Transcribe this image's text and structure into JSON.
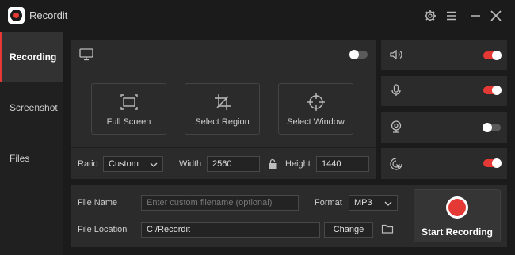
{
  "app": {
    "title": "Recordit"
  },
  "titlebar": {
    "icons": [
      "gear-icon",
      "menu-icon",
      "minimize-icon",
      "close-icon"
    ]
  },
  "sidebar": {
    "items": [
      {
        "label": "Recording",
        "active": true
      },
      {
        "label": "Screenshot",
        "active": false
      },
      {
        "label": "Files",
        "active": false
      }
    ]
  },
  "screen": {
    "toggle_on": false
  },
  "modes": [
    {
      "label": "Full Screen"
    },
    {
      "label": "Select Region"
    },
    {
      "label": "Select Window"
    }
  ],
  "ratio": {
    "label": "Ratio",
    "value": "Custom"
  },
  "size": {
    "width_label": "Width",
    "width": "2560",
    "height_label": "Height",
    "height": "1440"
  },
  "audio": [
    {
      "icon": "speaker-icon",
      "on": true
    },
    {
      "icon": "microphone-icon",
      "on": true
    },
    {
      "icon": "webcam-icon",
      "on": false
    },
    {
      "icon": "cursor-icon",
      "on": true
    }
  ],
  "file": {
    "name_label": "File Name",
    "name_placeholder": "Enter custom filename (optional)",
    "format_label": "Format",
    "format": "MP3",
    "location_label": "File Location",
    "location": "C:/Recordit",
    "change_label": "Change"
  },
  "record": {
    "label": "Start Recording"
  },
  "colors": {
    "accent": "#e53935",
    "panel": "#2b2b2b",
    "background": "#1b1b1b"
  }
}
